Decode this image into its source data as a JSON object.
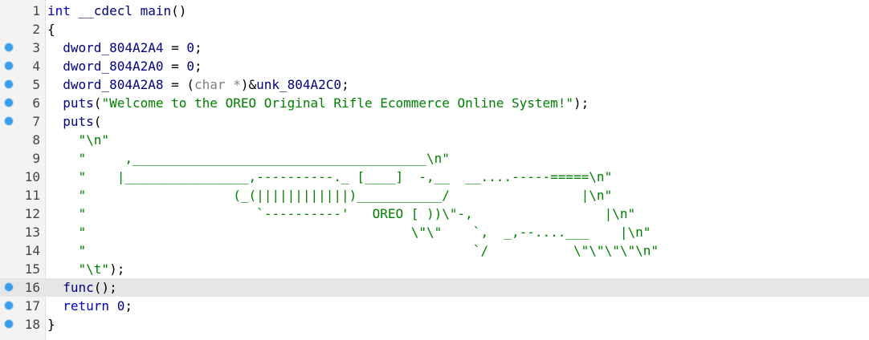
{
  "editor": {
    "lines": [
      {
        "no": "1",
        "bp": false,
        "hl": false,
        "parts": [
          [
            "kw",
            "int "
          ],
          [
            "ident",
            "__cdecl main"
          ],
          [
            "punct",
            "()"
          ]
        ]
      },
      {
        "no": "2",
        "bp": false,
        "hl": false,
        "parts": [
          [
            "punct",
            "{"
          ]
        ]
      },
      {
        "no": "3",
        "bp": true,
        "hl": false,
        "parts": [
          [
            "ident",
            "  dword_804A2A4 "
          ],
          [
            "punct",
            "= "
          ],
          [
            "num",
            "0"
          ],
          [
            "punct",
            ";"
          ]
        ]
      },
      {
        "no": "4",
        "bp": true,
        "hl": false,
        "parts": [
          [
            "ident",
            "  dword_804A2A0 "
          ],
          [
            "punct",
            "= "
          ],
          [
            "num",
            "0"
          ],
          [
            "punct",
            ";"
          ]
        ]
      },
      {
        "no": "5",
        "bp": true,
        "hl": false,
        "parts": [
          [
            "ident",
            "  dword_804A2A8 "
          ],
          [
            "punct",
            "= ("
          ],
          [
            "cast",
            "char *"
          ],
          [
            "punct",
            ")&"
          ],
          [
            "ident",
            "unk_804A2C0"
          ],
          [
            "punct",
            ";"
          ]
        ]
      },
      {
        "no": "6",
        "bp": true,
        "hl": false,
        "parts": [
          [
            "ident",
            "  puts"
          ],
          [
            "punct",
            "("
          ],
          [
            "str",
            "\"Welcome to the OREO Original Rifle Ecommerce Online System!\""
          ],
          [
            "punct",
            ");"
          ]
        ]
      },
      {
        "no": "7",
        "bp": true,
        "hl": false,
        "parts": [
          [
            "ident",
            "  puts"
          ],
          [
            "punct",
            "("
          ]
        ]
      },
      {
        "no": "8",
        "bp": false,
        "hl": false,
        "parts": [
          [
            "str",
            "    \"\\n\""
          ]
        ]
      },
      {
        "no": "9",
        "bp": false,
        "hl": false,
        "parts": [
          [
            "str",
            "    \"     ,______________________________________\\n\""
          ]
        ]
      },
      {
        "no": "10",
        "bp": false,
        "hl": false,
        "parts": [
          [
            "str",
            "    \"    |________________,----------._ [____]  -,__  __....-----=====\\n\""
          ]
        ]
      },
      {
        "no": "11",
        "bp": false,
        "hl": false,
        "parts": [
          [
            "str",
            "    \"                   (_(||||||||||||)___________/                 |\\n\""
          ]
        ]
      },
      {
        "no": "12",
        "bp": false,
        "hl": false,
        "parts": [
          [
            "str",
            "    \"                      `----------'   OREO [ ))\\\"-,                 |\\n\""
          ]
        ]
      },
      {
        "no": "13",
        "bp": false,
        "hl": false,
        "parts": [
          [
            "str",
            "    \"                                          \\\"\\\"    `,  _,--....___    |\\n\""
          ]
        ]
      },
      {
        "no": "14",
        "bp": false,
        "hl": false,
        "parts": [
          [
            "str",
            "    \"                                                  `/           \\\"\\\"\\\"\\\"\\n\""
          ]
        ]
      },
      {
        "no": "15",
        "bp": false,
        "hl": false,
        "parts": [
          [
            "str",
            "    \"\\t\""
          ],
          [
            "punct",
            ");"
          ]
        ]
      },
      {
        "no": "16",
        "bp": true,
        "hl": true,
        "parts": [
          [
            "ident",
            "  func"
          ],
          [
            "punct",
            "();"
          ]
        ]
      },
      {
        "no": "17",
        "bp": true,
        "hl": false,
        "parts": [
          [
            "kw",
            "  return "
          ],
          [
            "num",
            "0"
          ],
          [
            "punct",
            ";"
          ]
        ]
      },
      {
        "no": "18",
        "bp": true,
        "hl": false,
        "parts": [
          [
            "punct",
            "}"
          ]
        ]
      }
    ]
  }
}
